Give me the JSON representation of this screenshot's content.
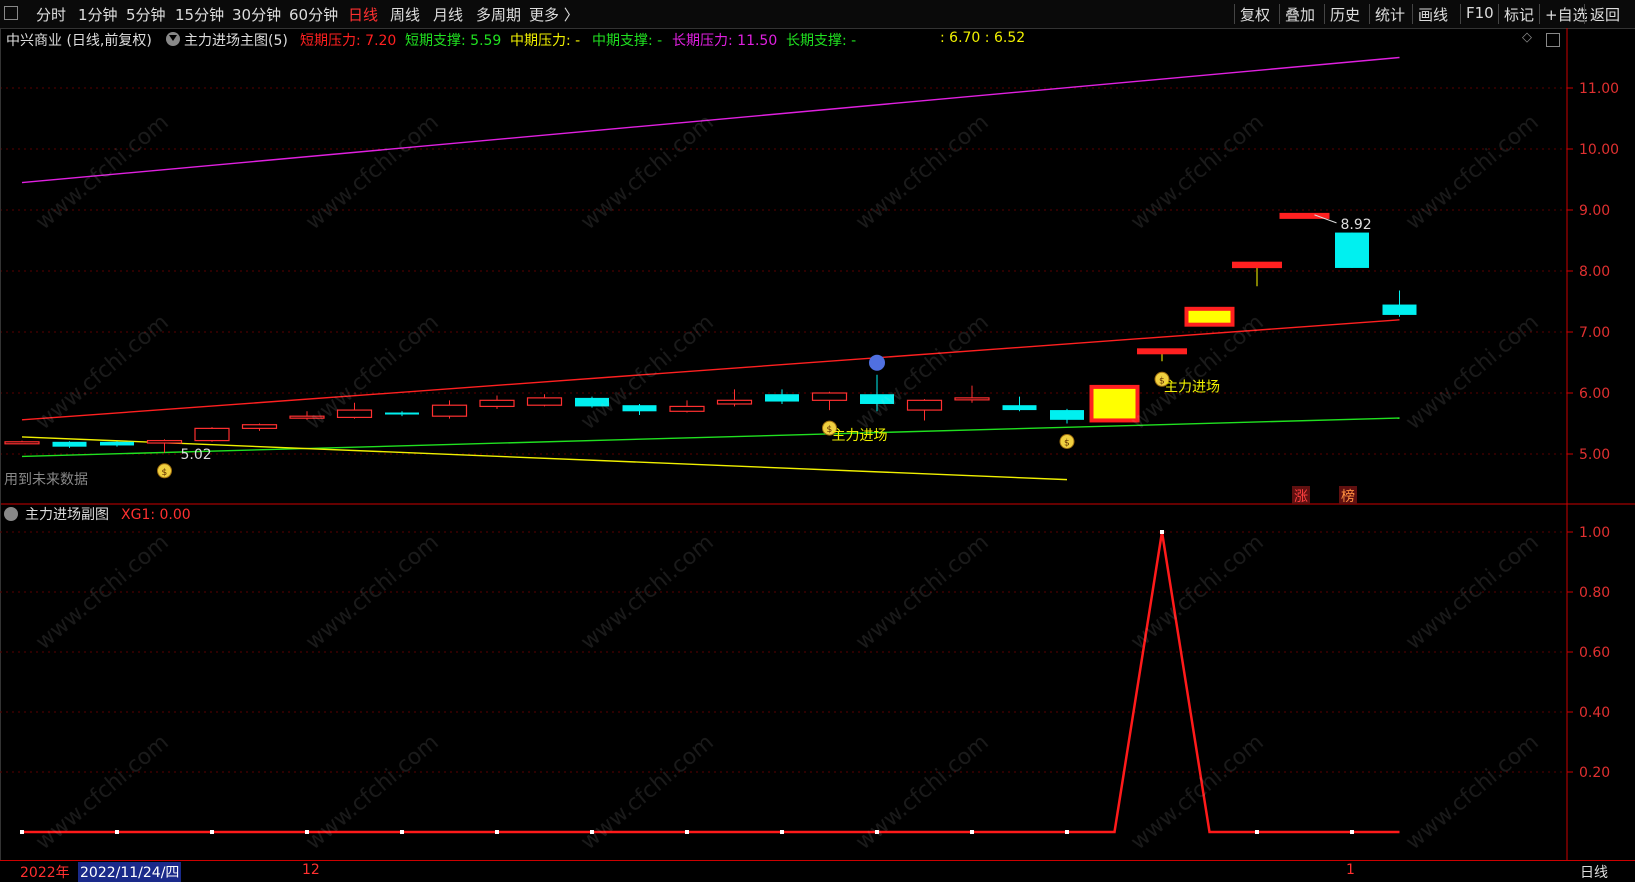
{
  "toolbar": {
    "periods": [
      "分时",
      "1分钟",
      "5分钟",
      "15分钟",
      "30分钟",
      "60分钟",
      "日线",
      "周线",
      "月线",
      "多周期",
      "更多 〉"
    ],
    "active": "日线",
    "right_buttons": [
      "复权",
      "叠加",
      "历史",
      "统计",
      "画线",
      "F10",
      "标记",
      "+自选",
      "返回"
    ]
  },
  "legend": {
    "stock": "中兴商业 (日线,前复权)",
    "indicator": "主力进场主图(5)",
    "items": [
      {
        "label": "短期压力: 7.20",
        "color": "#ff2020"
      },
      {
        "label": "短期支撑: 5.59",
        "color": "#20e020"
      },
      {
        "label": "中期压力: -",
        "color": "#f0f000"
      },
      {
        "label": "中期支撑: -",
        "color": "#20e020"
      },
      {
        "label": "长期压力: 11.50",
        "color": "#e020e0"
      },
      {
        "label": "长期支撑: -",
        "color": "#20e020"
      },
      {
        "label": ": 6.70 : 6.52",
        "color": "#f0f000"
      }
    ]
  },
  "future_note": "用到未来数据",
  "badges": [
    "涨",
    "榜"
  ],
  "annotations": {
    "high": "8.92",
    "low": "5.02",
    "signal": "主力进场"
  },
  "sub_legend": {
    "name": "主力进场副图",
    "value": "XG1: 0.00"
  },
  "main_axis": [
    "11.00",
    "10.00",
    "9.00",
    "8.00",
    "7.00",
    "6.00",
    "5.00"
  ],
  "sub_axis": [
    "1.00",
    "0.80",
    "0.60",
    "0.40",
    "0.20"
  ],
  "bottom": {
    "year": "2022年",
    "date": "2022/11/24/四",
    "month12": "12",
    "month1": "1",
    "period": "日线"
  },
  "watermark": "www.cfchi.com",
  "colors": {
    "up": "#ff3030",
    "down": "#00f0f0",
    "limit_up": "#ffff00",
    "bg": "#000000"
  },
  "chart_data": {
    "type": "candlestick",
    "candles": [
      {
        "o": 5.2,
        "c": 5.2,
        "h": 5.22,
        "l": 5.17
      },
      {
        "o": 5.2,
        "c": 5.12,
        "h": 5.21,
        "l": 5.1
      },
      {
        "o": 5.2,
        "c": 5.14,
        "h": 5.21,
        "l": 5.12
      },
      {
        "o": 5.18,
        "c": 5.22,
        "h": 5.24,
        "l": 5.02
      },
      {
        "o": 5.22,
        "c": 5.42,
        "h": 5.44,
        "l": 5.2
      },
      {
        "o": 5.42,
        "c": 5.48,
        "h": 5.5,
        "l": 5.38
      },
      {
        "o": 5.6,
        "c": 5.62,
        "h": 5.7,
        "l": 5.56
      },
      {
        "o": 5.6,
        "c": 5.72,
        "h": 5.84,
        "l": 5.58
      },
      {
        "o": 5.68,
        "c": 5.67,
        "h": 5.7,
        "l": 5.62
      },
      {
        "o": 5.62,
        "c": 5.8,
        "h": 5.88,
        "l": 5.58
      },
      {
        "o": 5.78,
        "c": 5.88,
        "h": 5.96,
        "l": 5.74
      },
      {
        "o": 5.8,
        "c": 5.92,
        "h": 5.98,
        "l": 5.78
      },
      {
        "o": 5.92,
        "c": 5.78,
        "h": 5.94,
        "l": 5.76
      },
      {
        "o": 5.8,
        "c": 5.7,
        "h": 5.82,
        "l": 5.64
      },
      {
        "o": 5.7,
        "c": 5.78,
        "h": 5.88,
        "l": 5.68
      },
      {
        "o": 5.82,
        "c": 5.88,
        "h": 6.06,
        "l": 5.78
      },
      {
        "o": 5.98,
        "c": 5.86,
        "h": 6.06,
        "l": 5.82
      },
      {
        "o": 5.88,
        "c": 6.0,
        "h": 6.02,
        "l": 5.72
      },
      {
        "o": 5.98,
        "c": 5.82,
        "h": 6.3,
        "l": 5.7
      },
      {
        "o": 5.72,
        "c": 5.88,
        "h": 5.9,
        "l": 5.55
      },
      {
        "o": 5.9,
        "c": 5.92,
        "h": 6.12,
        "l": 5.84
      },
      {
        "o": 5.8,
        "c": 5.72,
        "h": 5.94,
        "l": 5.7
      },
      {
        "o": 5.72,
        "c": 5.56,
        "h": 5.74,
        "l": 5.5
      },
      {
        "o": 5.55,
        "c": 6.1,
        "h": 6.1,
        "l": 5.55,
        "limit": true
      },
      {
        "o": 6.7,
        "c": 6.7,
        "h": 6.7,
        "l": 6.52,
        "limit": true
      },
      {
        "o": 7.12,
        "c": 7.38,
        "h": 7.38,
        "l": 7.1,
        "limit": true
      },
      {
        "o": 8.08,
        "c": 8.12,
        "h": 8.12,
        "l": 7.75,
        "limit": true
      },
      {
        "o": 8.92,
        "c": 8.92,
        "h": 8.92,
        "l": 8.92,
        "limit": true
      },
      {
        "o": 8.63,
        "c": 8.05,
        "h": 8.63,
        "l": 8.05
      },
      {
        "o": 7.45,
        "c": 7.28,
        "h": 7.68,
        "l": 7.25
      }
    ],
    "lines": [
      {
        "name": "短期压力",
        "color": "#ff2020",
        "from": [
          0,
          5.56
        ],
        "to": [
          29,
          7.2
        ]
      },
      {
        "name": "短期支撑",
        "color": "#20e020",
        "from": [
          0,
          4.96
        ],
        "to": [
          29,
          5.59
        ]
      },
      {
        "name": "中期压力",
        "color": "#f0f000",
        "from": [
          0,
          5.28
        ],
        "to": [
          22,
          4.58
        ]
      },
      {
        "name": "长期压力",
        "color": "#e020e0",
        "from": [
          0,
          9.45
        ],
        "to": [
          29,
          11.5
        ]
      }
    ],
    "signals": [
      3,
      17,
      22,
      24
    ],
    "sub_series": {
      "name": "XG1",
      "values": [
        0,
        0,
        0,
        0,
        0,
        0,
        0,
        0,
        0,
        0,
        0,
        0,
        0,
        0,
        0,
        0,
        0,
        0,
        0,
        0,
        0,
        0,
        0,
        0,
        1,
        0,
        0,
        0,
        0,
        0
      ]
    },
    "ylim": [
      4.4,
      11.9
    ],
    "sub_ylim": [
      0,
      1.05
    ]
  }
}
